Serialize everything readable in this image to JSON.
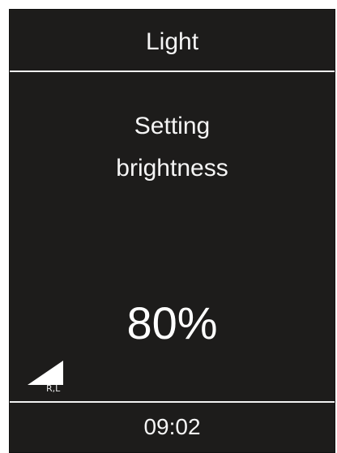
{
  "header": {
    "title": "Light"
  },
  "message": {
    "line1": "Setting",
    "line2": "brightness"
  },
  "brightness": {
    "value_text": "80%",
    "level": 0.8
  },
  "indicator": {
    "icon": "signal-ramp-icon",
    "label": "R,L"
  },
  "footer": {
    "time": "09:02"
  },
  "colors": {
    "background": "#1d1c1b",
    "foreground": "#ffffff"
  }
}
